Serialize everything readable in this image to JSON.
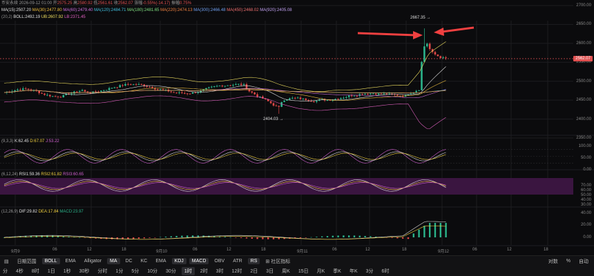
{
  "header": {
    "line1": {
      "pair": "币安永续",
      "datetime": "2026-09-12 01:00",
      "open_label": "开",
      "open": "2575.25",
      "high_label": "高",
      "high": "2580.92",
      "low_label": "低",
      "low": "2561.61",
      "close_label": "收",
      "close": "2562.07",
      "change_label": "涨幅",
      "change": "-0.55%(-14.17)",
      "amp_label": "振幅",
      "amp": "0.75%"
    },
    "ma_line": [
      {
        "text": "MA(15):2507.20",
        "color": "#e0e0e0"
      },
      {
        "text": "MA(30):2477.80",
        "color": "#f0c040"
      },
      {
        "text": "MA(60):2479.40",
        "color": "#d070e0"
      },
      {
        "text": "MA(120):2484.71",
        "color": "#40c0e0"
      },
      {
        "text": "MA(180):2481.65",
        "color": "#80e080"
      },
      {
        "text": "MA(220):2474.13",
        "color": "#f08040"
      },
      {
        "text": "MA(300):2466.48",
        "color": "#70a0f0"
      },
      {
        "text": "MA(450):2468.02",
        "color": "#f07070"
      },
      {
        "text": "MA(920):2405.08",
        "color": "#c0a0f0"
      }
    ],
    "boll_line": [
      {
        "text": "(20,2)",
        "color": "#8a8a8a"
      },
      {
        "text": "BOLL:2492.19",
        "color": "#e0e0e0"
      },
      {
        "text": "UB:2607.92",
        "color": "#f0e060"
      },
      {
        "text": "LB:2371.45",
        "color": "#e060c0"
      }
    ]
  },
  "price_axis": [
    "2700.00",
    "2650.00",
    "2600.00",
    "2550.00",
    "2500.00",
    "2450.00",
    "2400.00",
    "2350.00"
  ],
  "current_price": "2562.07",
  "annotations": {
    "high": "2667.35 →",
    "low": "2404.03 →"
  },
  "kdj": {
    "params": "(9,3,3)",
    "k": "K:62.45",
    "d": "D:67.07",
    "j": "J:53.22",
    "axis": [
      "100.00",
      "50.00",
      "0.00"
    ]
  },
  "rsi": {
    "params": "(6,12,24)",
    "rsi1": "RSI1:59.36",
    "rsi2": "RSI2:61.82",
    "rsi3": "RSI3:60.65",
    "axis": [
      "70.00",
      "60.00",
      "50.00",
      "40.00",
      "30.00"
    ]
  },
  "macd": {
    "params": "(12,26,9)",
    "dif": "DIF:29.82",
    "dea": "DEA:17.84",
    "macd": "MACD:23.97",
    "axis": [
      "40.00",
      "20.00",
      "0.00"
    ]
  },
  "time_axis": [
    "9月9",
    "06",
    "12",
    "18",
    "9月10",
    "06",
    "12",
    "18",
    "9月11",
    "06",
    "12",
    "18",
    "9月12",
    "06",
    "12",
    "18"
  ],
  "toolbar1": {
    "left_icon_label": "▤",
    "items": [
      {
        "label": "日期范围",
        "active": false
      },
      {
        "label": "BOLL",
        "active": true
      },
      {
        "label": "EMA",
        "active": false
      },
      {
        "label": "Alligator",
        "active": false
      },
      {
        "label": "MA",
        "active": true
      },
      {
        "label": "DC",
        "active": false
      },
      {
        "label": "KC",
        "active": false
      },
      {
        "label": "EMA",
        "active": false
      },
      {
        "label": "KDJ",
        "active": true
      },
      {
        "label": "MACD",
        "active": true
      },
      {
        "label": "OBV",
        "active": false
      },
      {
        "label": "ATR",
        "active": false
      },
      {
        "label": "RS",
        "active": true
      },
      {
        "label": "⊞ 社区指标",
        "active": false
      }
    ],
    "right": [
      "对数",
      "%",
      "自动"
    ]
  },
  "toolbar2": {
    "items": [
      {
        "label": "分",
        "active": false
      },
      {
        "label": "4秒",
        "active": false
      },
      {
        "label": "8时",
        "active": false
      },
      {
        "label": "1日",
        "active": false
      },
      {
        "label": "1秒",
        "active": false
      },
      {
        "label": "30秒",
        "active": false
      },
      {
        "label": "分时",
        "active": false
      },
      {
        "label": "1分",
        "active": false
      },
      {
        "label": "5分",
        "active": false
      },
      {
        "label": "10分",
        "active": false
      },
      {
        "label": "30分",
        "active": false
      },
      {
        "label": "1时",
        "active": true
      },
      {
        "label": "2时",
        "active": false
      },
      {
        "label": "3时",
        "active": false
      },
      {
        "label": "12时",
        "active": false
      },
      {
        "label": "2日",
        "active": false
      },
      {
        "label": "3日",
        "active": false
      },
      {
        "label": "周K",
        "active": false
      },
      {
        "label": "15日",
        "active": false
      },
      {
        "label": "月K",
        "active": false
      },
      {
        "label": "季K",
        "active": false
      },
      {
        "label": "年K",
        "active": false
      },
      {
        "label": "3分",
        "active": false
      },
      {
        "label": "6时",
        "active": false
      }
    ]
  },
  "colors": {
    "up": "#2bb38a",
    "down": "#e04848",
    "arrow": "#f04040",
    "rsi_band": "#3a1540",
    "grid": "#1c1c20"
  }
}
